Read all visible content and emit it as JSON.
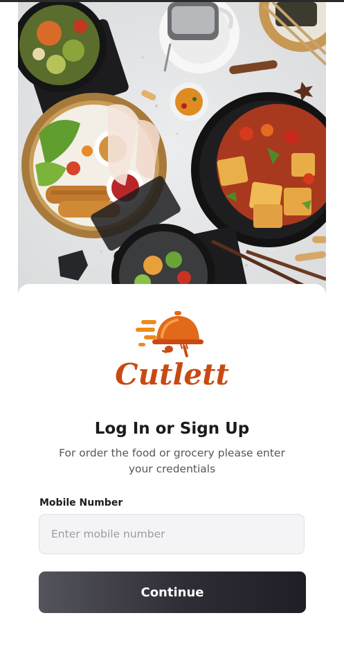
{
  "app": {
    "brand_name": "Cutlett"
  },
  "login": {
    "title": "Log In or Sign Up",
    "subtitle": "For order the food or grocery please enter your credentials",
    "mobile_label": "Mobile Number",
    "mobile_placeholder": "Enter mobile number",
    "mobile_value": "",
    "continue_label": "Continue"
  },
  "colors": {
    "brand": "#c84a12",
    "brand_light": "#f08a1c",
    "button_dark": "#2e2d35",
    "input_bg": "#f4f4f6"
  },
  "icons": {
    "logo": "delivery-cloche-logo-icon"
  }
}
